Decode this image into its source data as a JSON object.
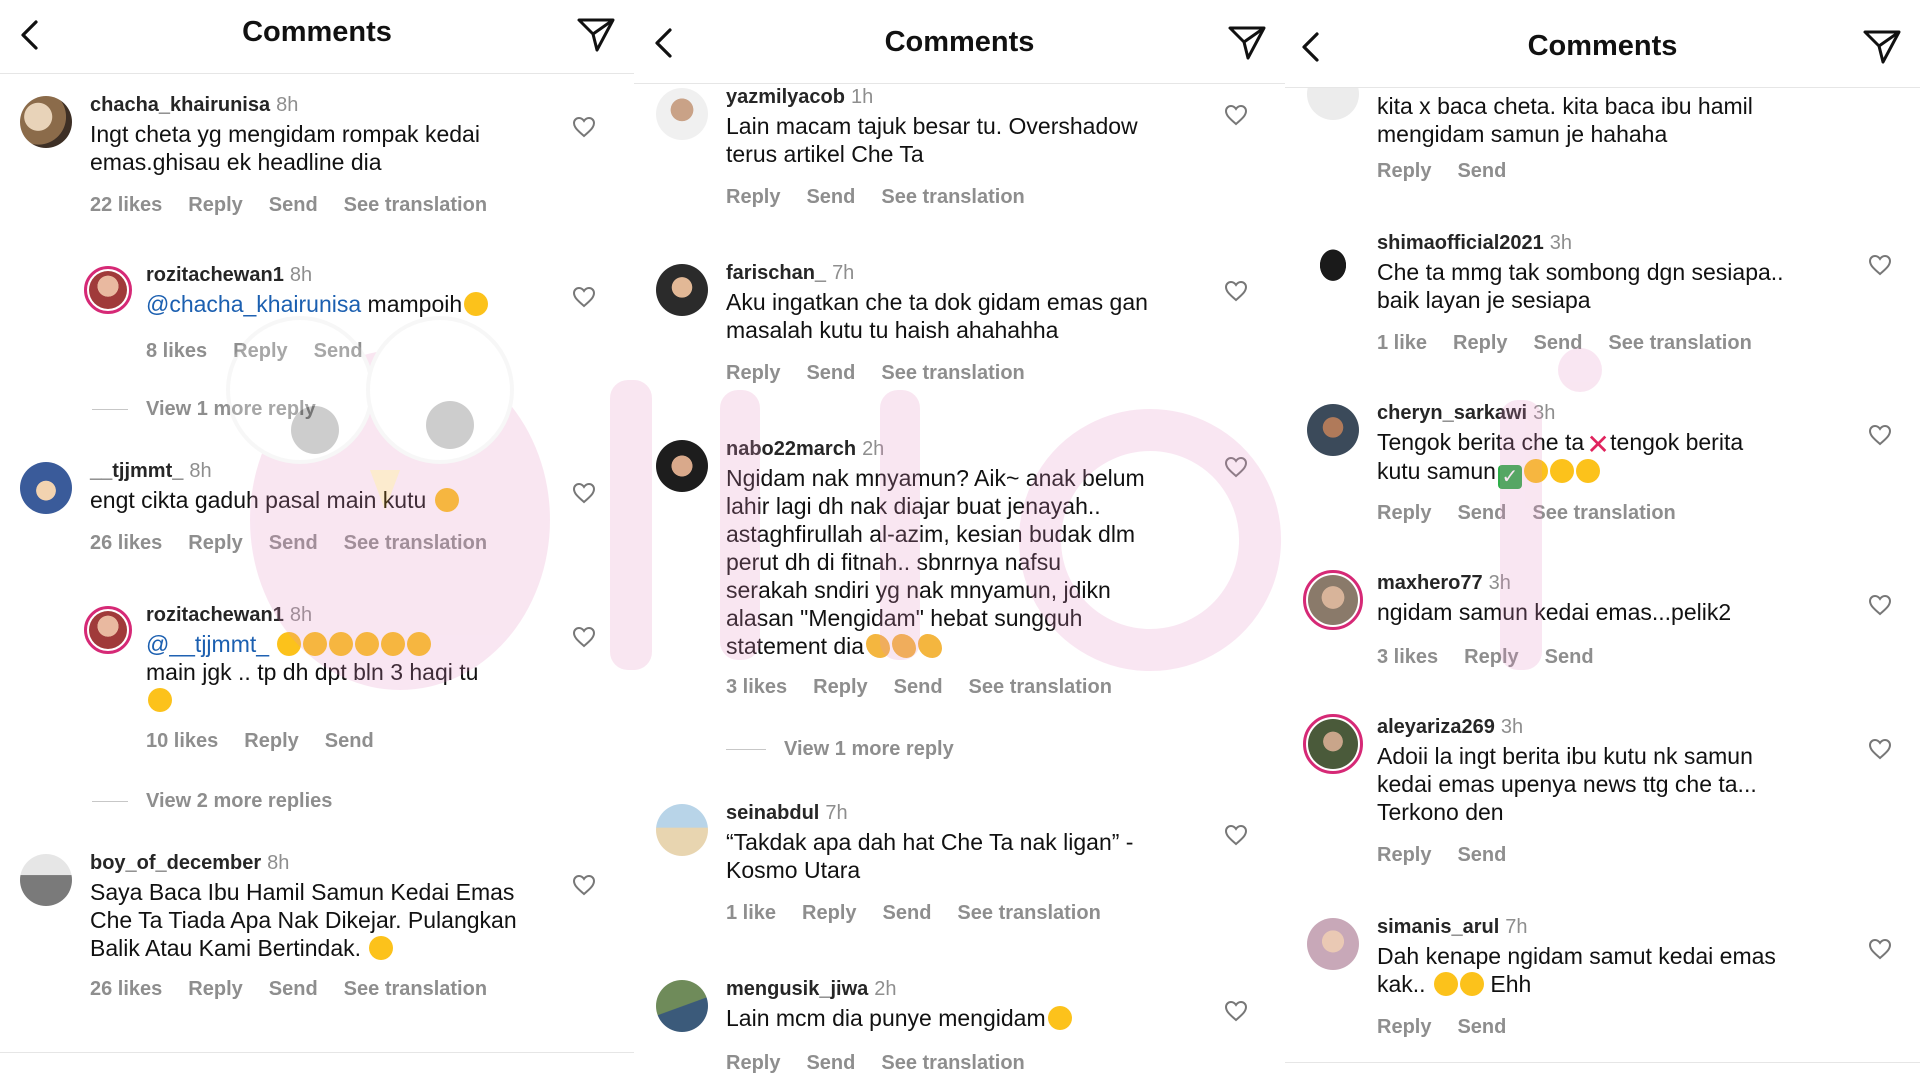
{
  "panels": [
    {
      "title": "Comments",
      "comments": [
        {
          "user": "chacha_khairunisa",
          "time": "8h",
          "text": "Ingt cheta yg mengidam rompak kedai\nemas.ghisau ek headline dia",
          "likes": "22 likes",
          "reply": "Reply",
          "send": "Send",
          "translate": "See translation"
        },
        {
          "user": "rozitachewan1",
          "time": "8h",
          "mention": "@chacha_khairunisa",
          "text": " mampoih",
          "likes": "8 likes",
          "reply": "Reply",
          "send": "Send"
        },
        {
          "view_more": "View 1 more reply"
        },
        {
          "user": "__tjjmmt_",
          "time": "8h",
          "text": "engt cikta gaduh pasal main kutu ",
          "likes": "26 likes",
          "reply": "Reply",
          "send": "Send",
          "translate": "See translation"
        },
        {
          "user": "rozitachewan1",
          "time": "8h",
          "mention": "@__tjjmmt_",
          "text": "main jgk .. tp dh dpt bln 3 haqi tu",
          "likes": "10 likes",
          "reply": "Reply",
          "send": "Send"
        },
        {
          "view_more": "View 2 more replies"
        },
        {
          "user": "boy_of_december",
          "time": "8h",
          "text": "Saya Baca Ibu Hamil Samun Kedai Emas\nChe Ta Tiada Apa Nak Dikejar. Pulangkan\nBalik Atau Kami Bertindak. ",
          "likes": "26 likes",
          "reply": "Reply",
          "send": "Send",
          "translate": "See translation"
        }
      ]
    },
    {
      "title": "Comments",
      "comments": [
        {
          "user": "yazmilyacob",
          "time": "1h",
          "text": "Lain macam tajuk besar tu. Overshadow\nterus artikel Che Ta",
          "reply": "Reply",
          "send": "Send",
          "translate": "See translation"
        },
        {
          "user": "farischan_",
          "time": "7h",
          "text": "Aku ingatkan che ta dok gidam emas gan\nmasalah kutu tu haish ahahahha",
          "reply": "Reply",
          "send": "Send",
          "translate": "See translation"
        },
        {
          "user": "nabo22march",
          "time": "2h",
          "text": "Ngidam nak mnyamun? Aik~ anak belum\nlahir lagi dh nak diajar buat jenayah..\nastaghfirullah al-azim, kesian budak dlm\nperut dh di fitnah.. sbnrnya nafsu\nserakah sndiri yg nak mnyamun, jdikn\nalasan \"Mengidam\" hebat sungguh\nstatement dia",
          "likes": "3 likes",
          "reply": "Reply",
          "send": "Send",
          "translate": "See translation"
        },
        {
          "view_more": "View 1 more reply"
        },
        {
          "user": "seinabdul",
          "time": "7h",
          "text": "“Takdak apa dah hat Che Ta nak ligan” -\nKosmo Utara",
          "likes": "1 like",
          "reply": "Reply",
          "send": "Send",
          "translate": "See translation"
        },
        {
          "user": "mengusik_jiwa",
          "time": "2h",
          "text": "Lain mcm dia punye mengidam",
          "reply": "Reply",
          "send": "Send",
          "translate": "See translation"
        }
      ]
    },
    {
      "title": "Comments",
      "comments": [
        {
          "text": "kita x baca cheta. kita baca ibu hamil\nmengidam samun je hahaha",
          "reply": "Reply",
          "send": "Send"
        },
        {
          "user": "shimaofficial2021",
          "time": "3h",
          "text": "Che ta mmg tak sombong dgn sesiapa..\nbaik layan je sesiapa",
          "likes": "1 like",
          "reply": "Reply",
          "send": "Send",
          "translate": "See translation"
        },
        {
          "user": "cheryn_sarkawi",
          "time": "3h",
          "text_a": "Tengok berita che ta",
          "text_b": "tengok berita",
          "text_c": "kutu samun",
          "reply": "Reply",
          "send": "Send",
          "translate": "See translation"
        },
        {
          "user": "maxhero77",
          "time": "3h",
          "text": "ngidam samun kedai emas...pelik2",
          "likes": "3 likes",
          "reply": "Reply",
          "send": "Send"
        },
        {
          "user": "aleyariza269",
          "time": "3h",
          "text": "Adoii la ingt berita ibu kutu nk samun\nkedai emas upenya news ttg che ta...\nTerkono den",
          "reply": "Reply",
          "send": "Send"
        },
        {
          "user": "simanis_arul",
          "time": "7h",
          "text_a": "Dah kenape ngidam samut kedai emas",
          "text_b": "kak..",
          "text_c": " Ehh",
          "reply": "Reply",
          "send": "Send"
        }
      ]
    }
  ],
  "colors": {
    "text": "#262626",
    "muted": "#8e8e8e",
    "mention": "#1b5fb0",
    "story_ring": "#d62976"
  }
}
